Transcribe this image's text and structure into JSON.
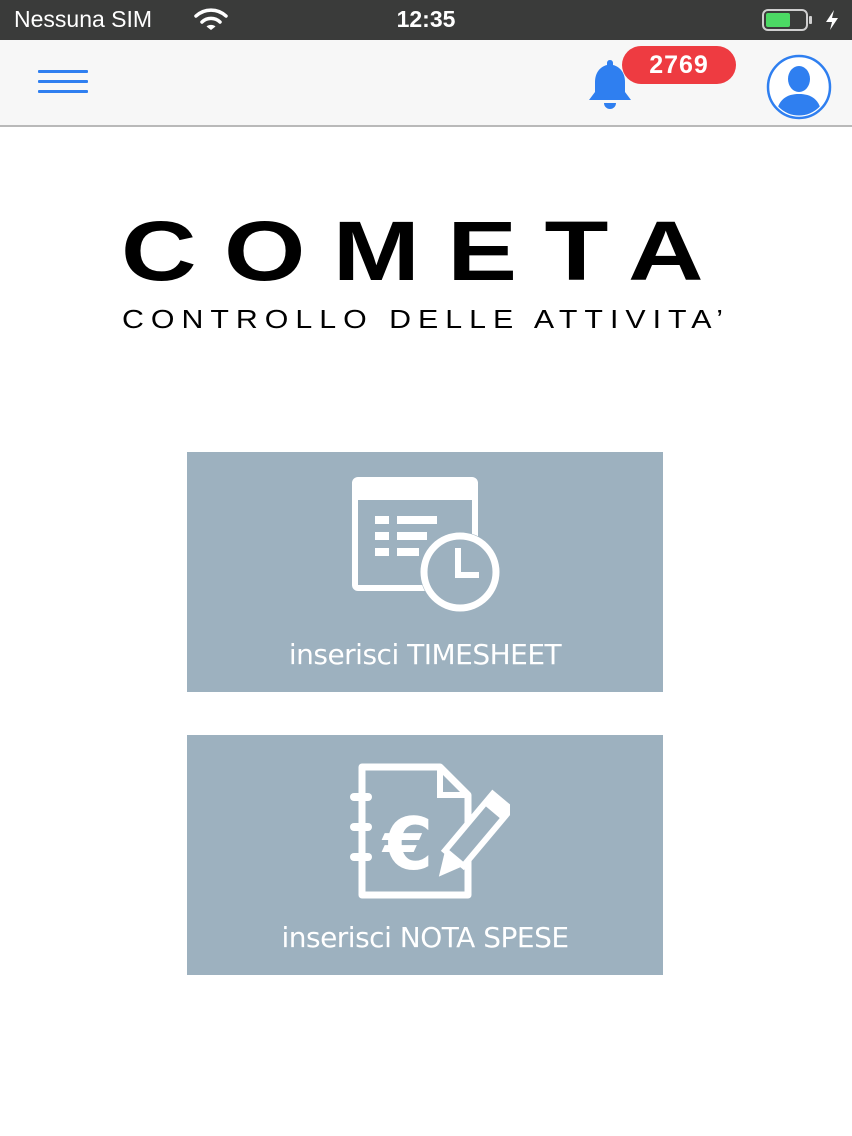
{
  "status_bar": {
    "carrier": "Nessuna SIM",
    "time": "12:35",
    "battery_color": "#4cd964"
  },
  "header": {
    "notification_count": "2769",
    "accent_color": "#2f7ff0",
    "badge_color": "#ee3b41",
    "icons": {
      "menu": "hamburger-menu-icon",
      "notifications": "bell-icon",
      "profile": "user-avatar-icon"
    }
  },
  "brand": {
    "name": "COMETA",
    "tagline": "CONTROLLO DELLE ATTIVITA’"
  },
  "actions": [
    {
      "label": "inserisci TIMESHEET",
      "icon": "calendar-clock-icon"
    },
    {
      "label": "inserisci NOTA SPESE",
      "icon": "euro-notebook-pencil-icon"
    }
  ],
  "tile_color": "#9db1bf"
}
